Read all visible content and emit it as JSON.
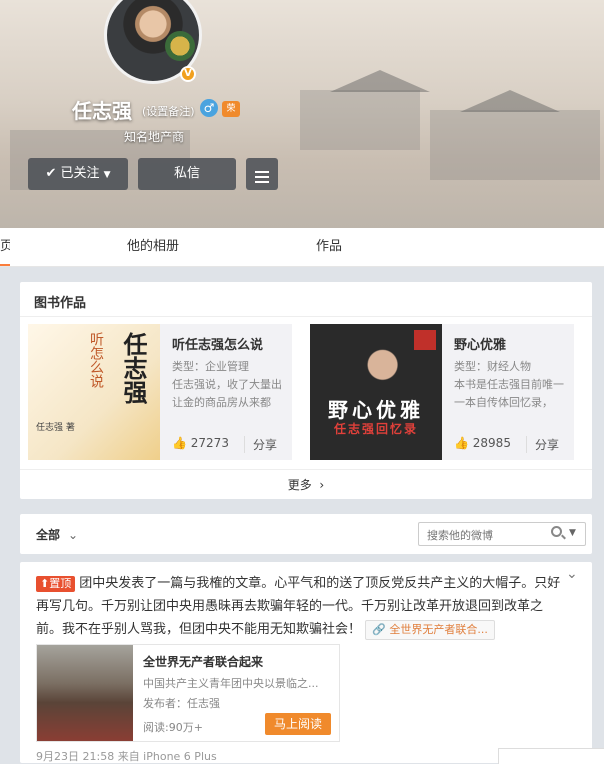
{
  "profile": {
    "name": "任志强",
    "remark": "(设置备注)",
    "bio": "知名地产商",
    "v_badge": "V",
    "gender_symbol": "♂",
    "medal_symbol": "荣"
  },
  "actions": {
    "follow": "已关注",
    "message": "私信"
  },
  "tabs": {
    "home": "页",
    "albums": "他的相册",
    "works": "作品"
  },
  "books_card": {
    "title": "图书作品",
    "more": "更多",
    "items": [
      {
        "title": "听任志强怎么说",
        "type": "类型：企业管理",
        "desc": "任志强说，收了大量出让金的商品房从来都不...",
        "likes": "27273",
        "share": "分享",
        "cover_main": "任志强",
        "cover_top": "听怎么说",
        "cover_author": "任志强 著"
      },
      {
        "title": "野心优雅",
        "type": "类型：财经人物",
        "desc": "本书是任志强目前唯一一本自传体回忆录，区...",
        "likes": "28985",
        "share": "分享",
        "cover_main": "野心优雅",
        "cover_sub": "任志强回忆录"
      }
    ]
  },
  "feed": {
    "filter": "全部",
    "search_placeholder": "搜索他的微博"
  },
  "post": {
    "pin_label": "置顶",
    "text": "团中央发表了一篇与我榷的文章。心平气和的送了顶反党反共产主义的大帽子。只好再写几句。千万别让团中央用愚昧再去欺骗年轻的一代。千万别让改革开放退回到改革之前。我不在乎别人骂我，但团中央不能用无知欺骗社会！",
    "link_text": "全世界无产者联合...",
    "card_title": "全世界无产者联合起来",
    "card_desc": "中国共产主义青年团中央以景临之...",
    "card_publisher": "发布者：任志强",
    "card_reads": "阅读:90万+",
    "card_button": "马上阅读",
    "meta": "9月23日 21:58 来自 iPhone 6 Plus"
  }
}
